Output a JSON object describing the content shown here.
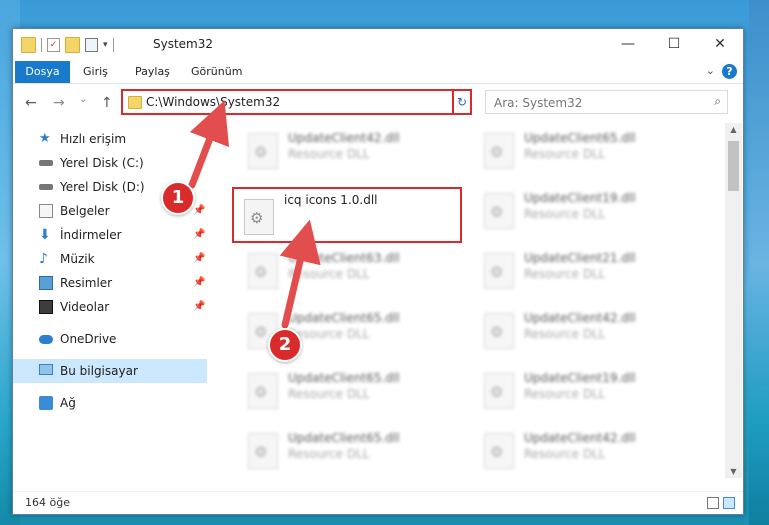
{
  "window": {
    "title": "System32",
    "controls": {
      "minimize": "—",
      "maximize": "☐",
      "close": "✕"
    }
  },
  "ribbon": {
    "tabs": [
      "Dosya",
      "Giriş",
      "Paylaş",
      "Görünüm"
    ],
    "help": "?",
    "expand": "⌄"
  },
  "nav": {
    "back": "←",
    "forward": "→",
    "recent": "⌄",
    "up": "↑",
    "address": "C:\\Windows\\System32",
    "address_dropdown": "⌄",
    "refresh": "↻",
    "search_placeholder": "Ara: System32",
    "search_icon": "⌕"
  },
  "sidebar": {
    "items": [
      {
        "label": "Hızlı erişim",
        "icon": "star-icon"
      },
      {
        "label": "Yerel Disk (C:)",
        "icon": "drive-icon"
      },
      {
        "label": "Yerel Disk (D:)",
        "icon": "drive-icon"
      },
      {
        "label": "Belgeler",
        "icon": "documents-icon",
        "pinned": true
      },
      {
        "label": "İndirmeler",
        "icon": "download-icon",
        "pinned": true
      },
      {
        "label": "Müzik",
        "icon": "music-icon",
        "pinned": true
      },
      {
        "label": "Resimler",
        "icon": "pictures-icon",
        "pinned": true
      },
      {
        "label": "Videolar",
        "icon": "videos-icon",
        "pinned": true
      },
      {
        "label": "OneDrive",
        "icon": "cloud-icon"
      },
      {
        "label": "Bu bilgisayar",
        "icon": "computer-icon",
        "selected": true
      },
      {
        "label": "Ağ",
        "icon": "network-icon"
      }
    ],
    "pin_glyph": "📌"
  },
  "files": [
    {
      "name": "UpdateClient42.dll",
      "type": "Resource DLL"
    },
    {
      "name": "UpdateClient65.dll",
      "type": "Resource DLL"
    },
    {
      "name": "icq icons 1.0.dll",
      "type": ""
    },
    {
      "name": "UpdateClient19.dll",
      "type": "Resource DLL"
    },
    {
      "name": "UpdateClient63.dll",
      "type": "Resource DLL"
    },
    {
      "name": "UpdateClient21.dll",
      "type": "Resource DLL"
    },
    {
      "name": "UpdateClient65.dll",
      "type": "Resource DLL"
    },
    {
      "name": "UpdateClient42.dll",
      "type": "Resource DLL"
    },
    {
      "name": "UpdateClient65.dll",
      "type": "Resource DLL"
    },
    {
      "name": "UpdateClient19.dll",
      "type": "Resource DLL"
    },
    {
      "name": "UpdateClient65.dll",
      "type": "Resource DLL"
    },
    {
      "name": "UpdateClient42.dll",
      "type": "Resource DLL"
    }
  ],
  "status": {
    "count": "164 öğe"
  },
  "callouts": [
    "1",
    "2"
  ],
  "colors": {
    "highlight": "#d92b2b",
    "accent": "#1979ca",
    "selected": "#cce8ff"
  }
}
